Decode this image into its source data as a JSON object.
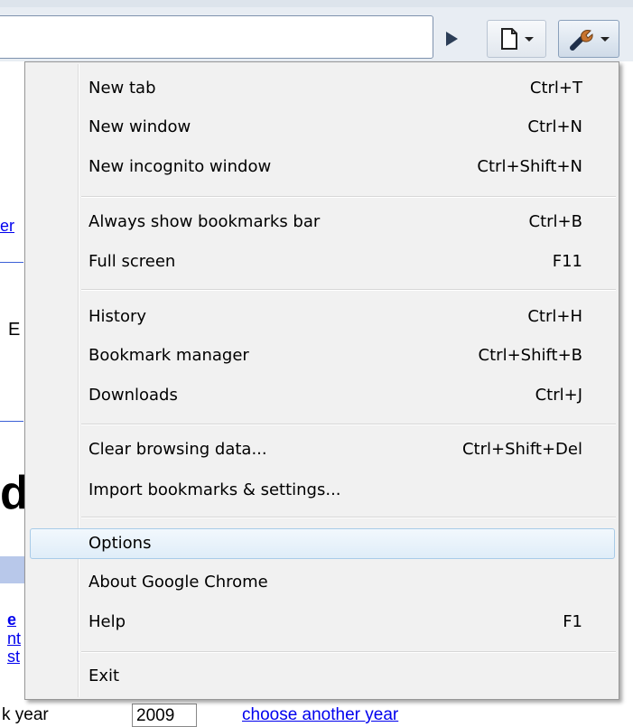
{
  "toolbar": {
    "icons": [
      "play-go-icon",
      "page-menu-icon",
      "wrench-icon"
    ]
  },
  "background": {
    "link_fragment_1": "er",
    "letter_b": "E",
    "big_letter": "d",
    "link_fragment_2": "e",
    "link_fragment_3": "nt",
    "link_fragment_4": "st",
    "bottom_text_1": "k year",
    "bottom_year": "2009",
    "bottom_link": "choose another year"
  },
  "menu": {
    "items": [
      {
        "label": "New tab",
        "shortcut": "Ctrl+T"
      },
      {
        "label": "New window",
        "shortcut": "Ctrl+N"
      },
      {
        "label": "New incognito window",
        "shortcut": "Ctrl+Shift+N"
      },
      {
        "label": "Always show bookmarks bar",
        "shortcut": "Ctrl+B"
      },
      {
        "label": "Full screen",
        "shortcut": "F11"
      },
      {
        "label": "History",
        "shortcut": "Ctrl+H"
      },
      {
        "label": "Bookmark manager",
        "shortcut": "Ctrl+Shift+B"
      },
      {
        "label": "Downloads",
        "shortcut": "Ctrl+J"
      },
      {
        "label": "Clear browsing data...",
        "shortcut": "Ctrl+Shift+Del"
      },
      {
        "label": "Import bookmarks & settings...",
        "shortcut": ""
      },
      {
        "label": "Options",
        "shortcut": ""
      },
      {
        "label": "About Google Chrome",
        "shortcut": ""
      },
      {
        "label": "Help",
        "shortcut": "F1"
      },
      {
        "label": "Exit",
        "shortcut": ""
      }
    ],
    "highlighted": "Options"
  }
}
